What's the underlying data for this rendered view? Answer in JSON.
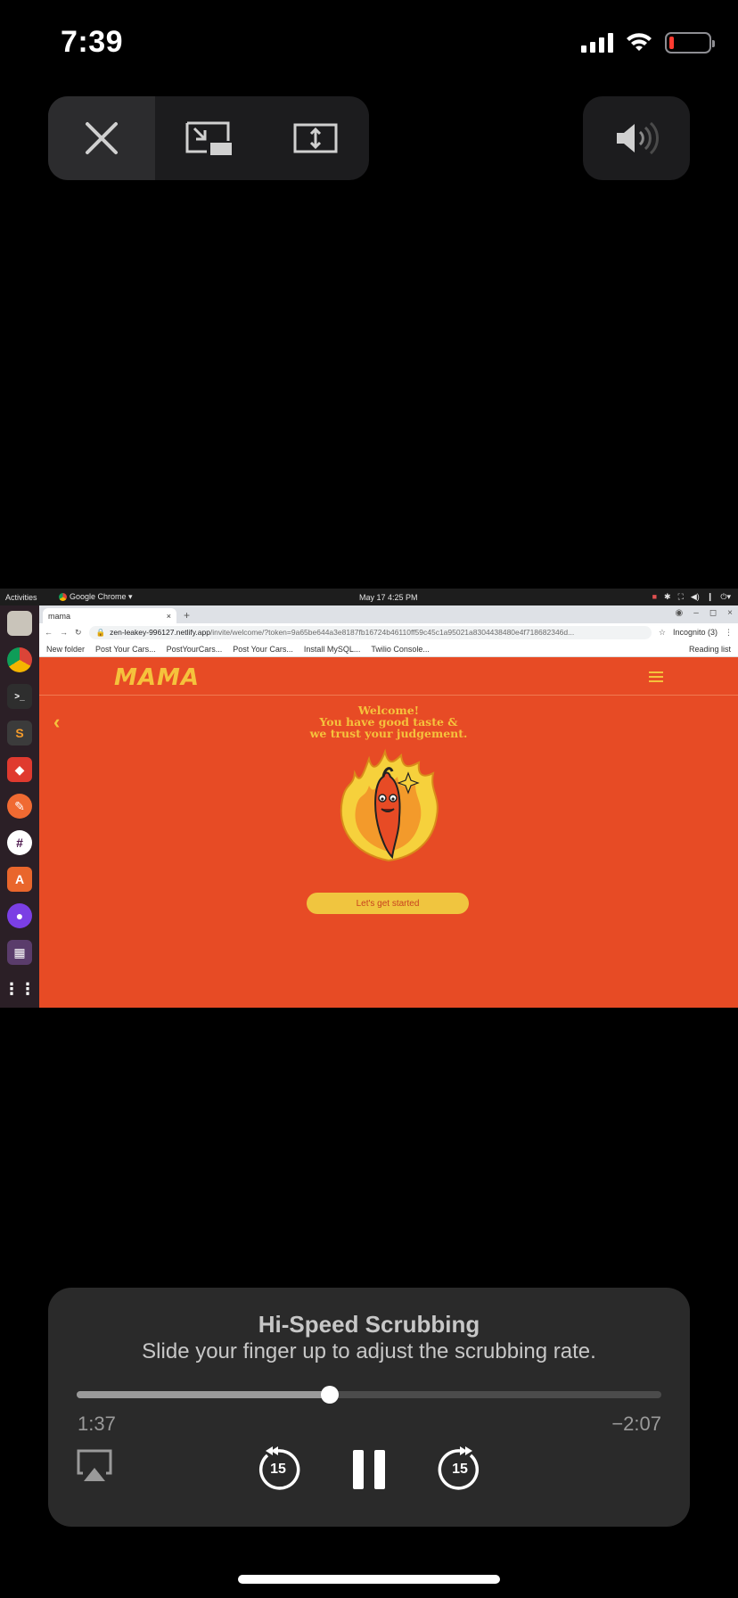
{
  "status_bar": {
    "time": "7:39",
    "battery_color": "#ff3b30"
  },
  "top_controls": {
    "close_icon": "close-icon",
    "pip_icon": "picture-in-picture-icon",
    "fit_icon": "aspect-fit-icon",
    "volume_icon": "speaker-muted-icon"
  },
  "video": {
    "ubuntu_bar": {
      "activities": "Activities",
      "app": "Google Chrome ▾",
      "date": "May 17  4:25 PM"
    },
    "chrome": {
      "tab_title": "mama",
      "url_host": "zen-leakey-996127.netlify.app",
      "url_rest": "/invite/welcome/?token=9a65be644a3e8187fb16724b46110ff59c45c1a95021a8304438480e4f718682346d...",
      "incognito": "Incognito (3)",
      "bookmarks": [
        "New folder",
        "Post Your Cars...",
        "PostYourCars...",
        "Post Your Cars...",
        "Install MySQL...",
        "Twilio Console..."
      ],
      "reading_list": "Reading list"
    },
    "site": {
      "logo": "MAMA",
      "welcome_lines": [
        "Welcome!",
        "You have good taste &",
        "we trust your judgement."
      ],
      "cta": "Let's get started"
    }
  },
  "scrubbing": {
    "title": "Hi-Speed Scrubbing",
    "subtitle": "Slide your finger up to adjust the scrubbing rate.",
    "elapsed": "1:37",
    "remaining": "−2:07",
    "progress": 0.433,
    "skip_back": "15",
    "skip_forward": "15"
  }
}
